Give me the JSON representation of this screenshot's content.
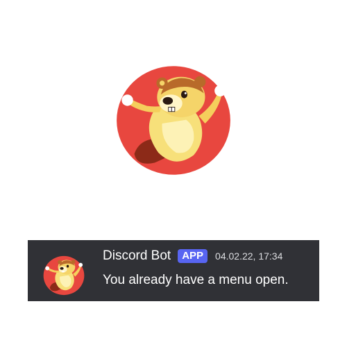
{
  "bot": {
    "avatar_icon": "beaver-mascot-icon"
  },
  "message": {
    "username": "Discord Bot",
    "badge": "APP",
    "timestamp": "04.02.22, 17:34",
    "text": "You already have a menu open."
  },
  "colors": {
    "avatar_background": "#e8473f",
    "message_background": "#303136",
    "badge": "#5865f2"
  }
}
